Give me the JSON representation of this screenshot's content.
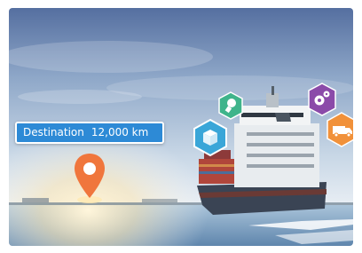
{
  "destination": {
    "label": "Destination",
    "distance": "12,000 km"
  },
  "icons": [
    {
      "name": "package-box-icon",
      "color": "#3aa6d8"
    },
    {
      "name": "lightbulb-icon",
      "color": "#3fb48b"
    },
    {
      "name": "gears-icon",
      "color": "#8b4aa9"
    },
    {
      "name": "delivery-truck-icon",
      "color": "#f1913a"
    }
  ],
  "colors": {
    "label_bg": "#2d8ad6",
    "pin": "#f0763c",
    "sky_top": "#5a78a8",
    "sea": "#7fa6c6"
  }
}
